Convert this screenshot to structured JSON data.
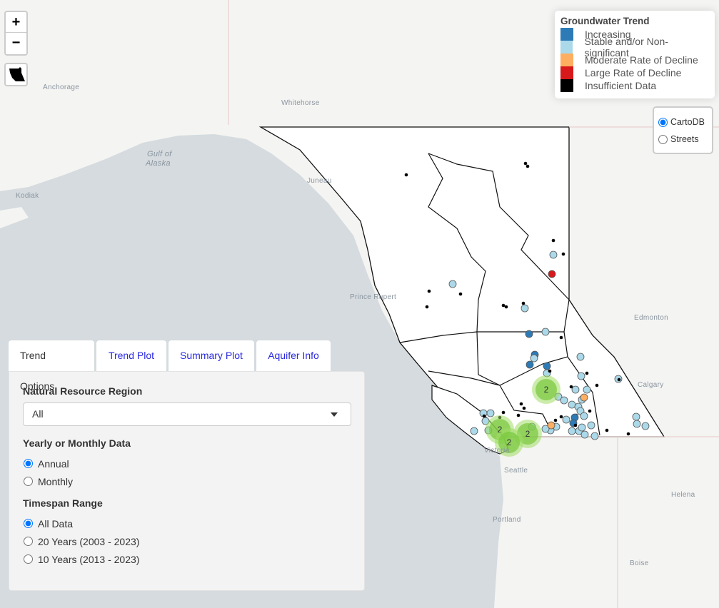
{
  "map": {
    "zoom_in": "+",
    "zoom_out": "−",
    "bc_button_icon": "bc-outline-icon",
    "places": [
      "Anchorage",
      "Whitehorse",
      "Gulf of",
      "Alaska",
      "Kodiak",
      "Juneau",
      "Prince Rupert",
      "Edmonton",
      "Calgary",
      "Victoria",
      "Seattle",
      "Portland",
      "Helena",
      "Boise"
    ],
    "clusters": [
      "2",
      "2",
      "2",
      "2"
    ]
  },
  "legend": {
    "title": "Groundwater Trend",
    "items": [
      {
        "label": "Increasing",
        "color": "#2c7bb6"
      },
      {
        "label": "Stable and/or Non-significant",
        "color": "#abd9e9"
      },
      {
        "label": "Moderate Rate of Decline",
        "color": "#fdae61"
      },
      {
        "label": "Large Rate of Decline",
        "color": "#d7191c"
      },
      {
        "label": "Insufficient Data",
        "color": "#000000"
      }
    ]
  },
  "layers": {
    "options": [
      "CartoDB",
      "Streets"
    ],
    "selected": "CartoDB"
  },
  "panel": {
    "tabs": [
      "Trend Options",
      "Trend Plot",
      "Summary Plot",
      "Aquifer Info"
    ],
    "active_tab": "Trend Options",
    "region_label": "Natural Resource Region",
    "region_value": "All",
    "data_label": "Yearly or Monthly Data",
    "data_options": [
      "Annual",
      "Monthly"
    ],
    "timespan_label": "Timespan Range",
    "timespan_options": [
      "All Data",
      "20 Years (2003 - 2023)",
      "10 Years (2013 - 2023)"
    ]
  }
}
